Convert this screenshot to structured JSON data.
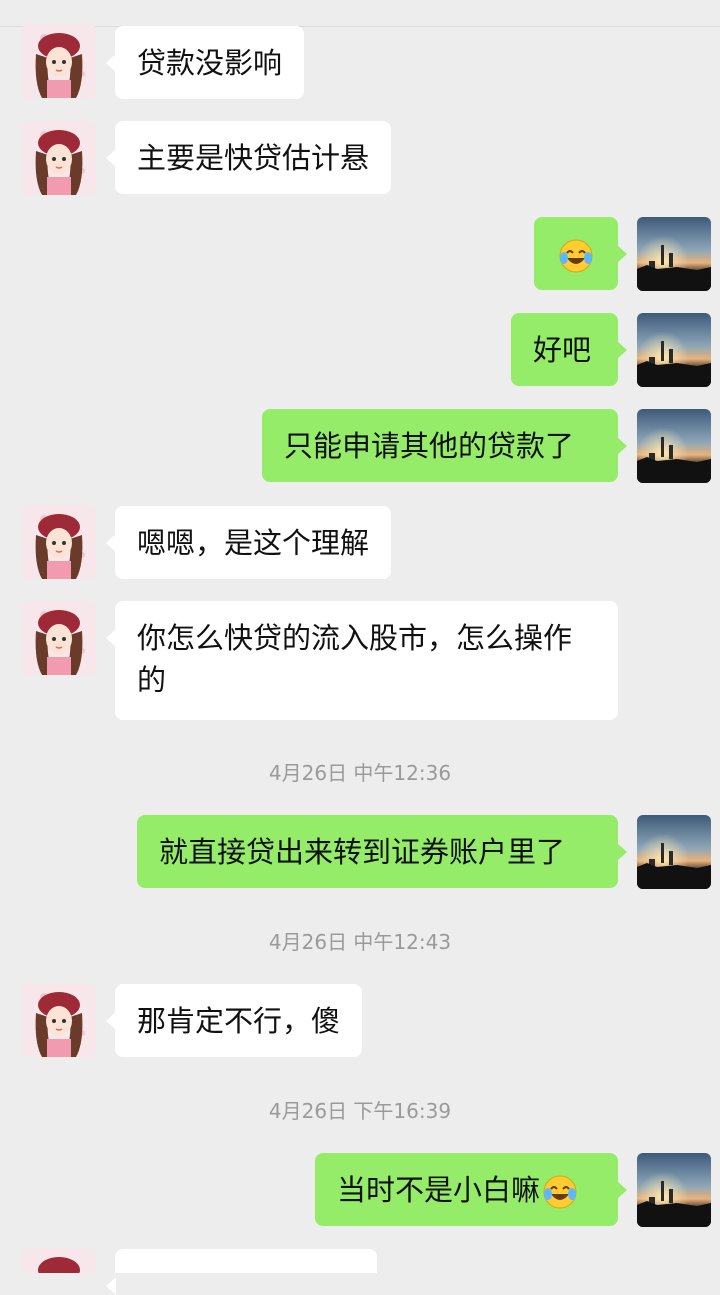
{
  "messages": [
    {
      "side": "left",
      "text": "贷款没影响"
    },
    {
      "side": "left",
      "text": "主要是快贷估计悬"
    },
    {
      "side": "right",
      "text": "",
      "emoji": "laugh-cry-emoji"
    },
    {
      "side": "right",
      "text": "好吧"
    },
    {
      "side": "right",
      "text": "只能申请其他的贷款了"
    },
    {
      "side": "left",
      "text": "嗯嗯，是这个理解"
    },
    {
      "side": "left",
      "text": "你怎么快贷的流入股市，怎么操作的"
    },
    {
      "side": "right",
      "text": "就直接贷出来转到证券账户里了"
    },
    {
      "side": "left",
      "text": "那肯定不行，傻"
    },
    {
      "side": "right",
      "text": "当时不是小白嘛",
      "emoji": "laugh-cry-emoji"
    }
  ],
  "timestamps": [
    "4月26日 中午12:36",
    "4月26日 中午12:43",
    "4月26日 下午16:39"
  ],
  "colors": {
    "background": "#ededed",
    "left_bubble": "#ffffff",
    "right_bubble": "#95ec69"
  }
}
